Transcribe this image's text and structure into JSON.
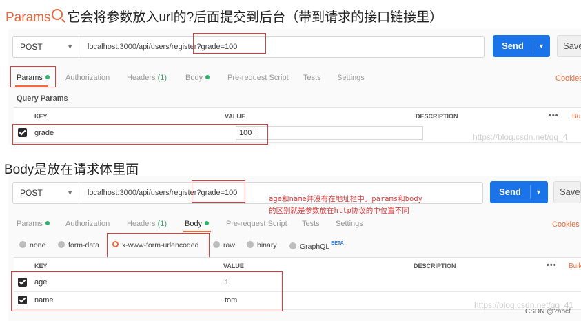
{
  "heading_params": {
    "keyword": "Params",
    "text": "它会将参数放入url的?后面提交到后台（带到请求的接口链接里）"
  },
  "heading_body": "Body是放在请求体里面",
  "request1": {
    "method": "POST",
    "url": "localhost:3000/api/users/register?grade=100",
    "send_label": "Send",
    "save_label": "Save"
  },
  "tabs1": [
    {
      "label": "Params",
      "dot": true
    },
    {
      "label": "Authorization"
    },
    {
      "label": "Headers",
      "count": "(1)"
    },
    {
      "label": "Body",
      "dot": true
    },
    {
      "label": "Pre-request Script"
    },
    {
      "label": "Tests"
    },
    {
      "label": "Settings"
    }
  ],
  "cookies_label": "Cookies",
  "query_params_label": "Query Params",
  "table_headers": {
    "key": "KEY",
    "value": "VALUE",
    "description": "DESCRIPTION"
  },
  "more_label": "•••",
  "bulk_label": "Bu",
  "bulk_label2": "Bulk",
  "params_rows": [
    {
      "key": "grade",
      "value": "100"
    }
  ],
  "watermark": "https://blog.csdn.net/qq_4",
  "request2": {
    "method": "POST",
    "url": "localhost:3000/api/users/register?grade=100",
    "send_label": "Send",
    "save_label": "Save"
  },
  "tabs2": [
    {
      "label": "Params",
      "dot": true
    },
    {
      "label": "Authorization"
    },
    {
      "label": "Headers",
      "count": "(1)"
    },
    {
      "label": "Body",
      "dot": true
    },
    {
      "label": "Pre-request Script"
    },
    {
      "label": "Tests"
    },
    {
      "label": "Settings"
    }
  ],
  "annotation": [
    "age和name并没有在地址栏中。params和body",
    "的区别就是参数放在http协议的中位置不同"
  ],
  "body_types": [
    {
      "label": "none",
      "selected": false
    },
    {
      "label": "form-data",
      "selected": false
    },
    {
      "label": "x-www-form-urlencoded",
      "selected": true
    },
    {
      "label": "raw",
      "selected": false
    },
    {
      "label": "binary",
      "selected": false
    },
    {
      "label": "GraphQL",
      "selected": false,
      "badge": "BETA"
    }
  ],
  "body_rows": [
    {
      "key": "age",
      "value": "1"
    },
    {
      "key": "name",
      "value": "tom"
    }
  ],
  "watermark2": "https://blog.csdn.net/qq_41",
  "csdn_credit": "CSDN @?abcf",
  "colors": {
    "accent": "#f26b3a",
    "send": "#1a73e8",
    "annotation_red": "#e03c3c",
    "dot_green": "#2db36a"
  }
}
